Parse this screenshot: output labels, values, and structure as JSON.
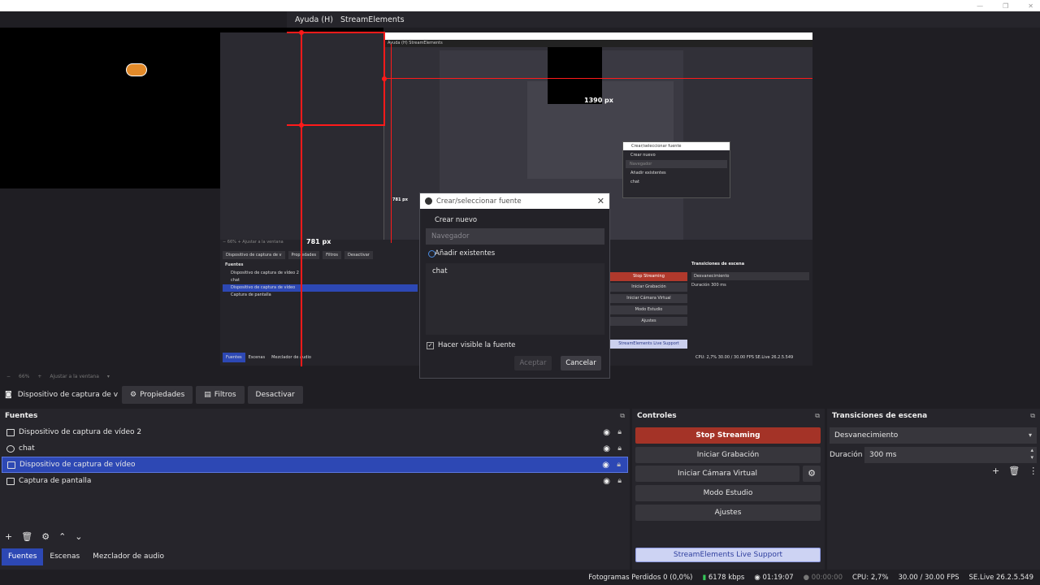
{
  "menubar": {
    "help": "Ayuda (H)",
    "streamelements": "StreamElements"
  },
  "preview": {
    "nested_dialog_title": "Crear/seleccionar fuente",
    "nested_create": "Crear nuevo",
    "nested_browser": "Navegador",
    "nested_existing": "Añadir existentes",
    "nested_chat": "chat",
    "px_1390": "1390 px",
    "px_781_small": "781 px",
    "px_781": "781 px",
    "nested_source_name": "Dispositivo de captura de v",
    "nested_props": "Propiedades",
    "nested_filters": "Filtros",
    "nested_deactivate": "Desactivar",
    "nested_sources_title": "Fuentes",
    "nested_sources": [
      "Dispositivo de captura de vídeo 2",
      "chat",
      "Dispositivo de captura de vídeo",
      "Captura de pantalla"
    ],
    "nested_controls": [
      "Stop Streaming",
      "Iniciar Grabación",
      "Iniciar Cámara Virtual",
      "Modo Estudio",
      "Ajustes"
    ],
    "nested_support": "StreamElements Live Support",
    "nested_transitions_title": "Transiciones de escena",
    "nested_transition": "Desvanecimiento",
    "nested_duration": "Duración",
    "nested_duration_value": "300 ms",
    "nested_tabs": [
      "Fuentes",
      "Escenas",
      "Mezclador de audio"
    ],
    "nested_status": "CPU: 2,7%   30.00 / 30.00 FPS   SE.Live 26.2.5.549"
  },
  "dialog": {
    "title": "Crear/seleccionar fuente",
    "create_new": "Crear nuevo",
    "name_placeholder": "Navegador",
    "add_existing": "Añadir existentes",
    "existing_items": [
      "chat"
    ],
    "make_visible": "Hacer visible la fuente",
    "accept": "Aceptar",
    "cancel": "Cancelar"
  },
  "zoom": {
    "minus": "−",
    "level": "66%",
    "plus": "+",
    "fit": "Ajustar a la ventana"
  },
  "source_toolbar": {
    "source_name": "Dispositivo de captura de v",
    "properties": "Propiedades",
    "filters": "Filtros",
    "deactivate": "Desactivar"
  },
  "sources": {
    "title": "Fuentes",
    "items": [
      {
        "label": "Dispositivo de captura de vídeo 2"
      },
      {
        "label": "chat"
      },
      {
        "label": "Dispositivo de captura de vídeo"
      },
      {
        "label": "Captura de pantalla"
      }
    ]
  },
  "tabs": {
    "sources": "Fuentes",
    "scenes": "Escenas",
    "audio_mixer": "Mezclador de audio"
  },
  "controls": {
    "title": "Controles",
    "stop_streaming": "Stop Streaming",
    "start_recording": "Iniciar Grabación",
    "start_virtual_cam": "Iniciar Cámara Virtual",
    "studio_mode": "Modo Estudio",
    "settings": "Ajustes",
    "live_support": "StreamElements Live Support"
  },
  "transitions": {
    "title": "Transiciones de escena",
    "selected": "Desvanecimiento",
    "duration_label": "Duración",
    "duration_value": "300 ms"
  },
  "status": {
    "dropped_frames": "Fotogramas Perdidos 0 (0,0%)",
    "bitrate": "6178 kbps",
    "stream_time": "01:19:07",
    "rec_time": "00:00:00",
    "cpu": "CPU: 2,7%",
    "fps": "30.00 / 30.00 FPS",
    "version": "SE.Live 26.2.5.549"
  }
}
